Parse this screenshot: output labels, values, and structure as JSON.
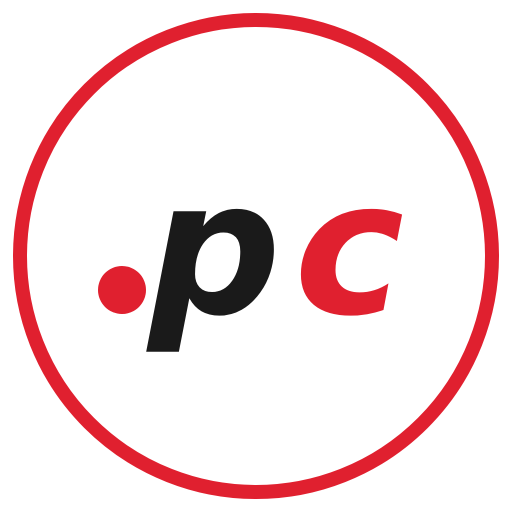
{
  "logo": {
    "dot": ".",
    "letter_p": "p",
    "letter_c": "c"
  },
  "colors": {
    "ring": "#e0202f",
    "dot": "#e0202f",
    "letter_p": "#1a1a1a",
    "letter_c": "#e0202f",
    "background": "#ffffff"
  }
}
